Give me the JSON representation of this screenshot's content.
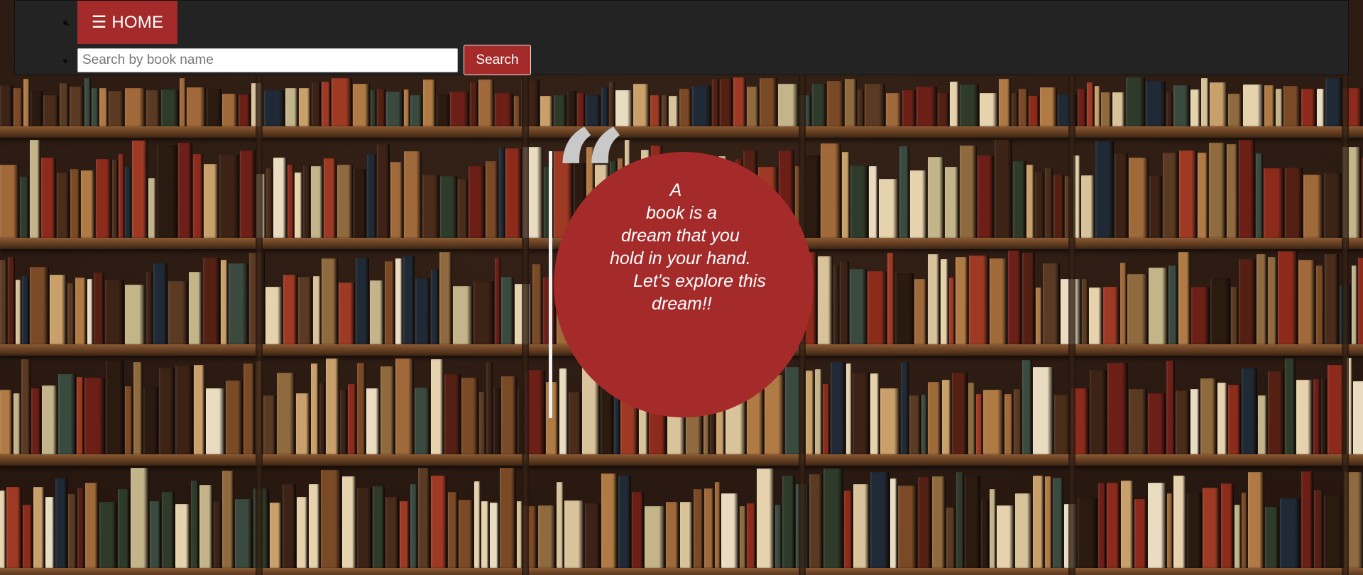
{
  "nav": {
    "home_label": "☰ HOME",
    "search_placeholder": "Search by book name",
    "search_button": "Search"
  },
  "quote": {
    "mark": "“",
    "lines": [
      "A",
      "book is a",
      "dream that you",
      "hold in your hand.",
      "Let's explore this",
      "dream!!"
    ]
  },
  "colors": {
    "accent": "#a52a2a",
    "navbar": "#232323"
  }
}
